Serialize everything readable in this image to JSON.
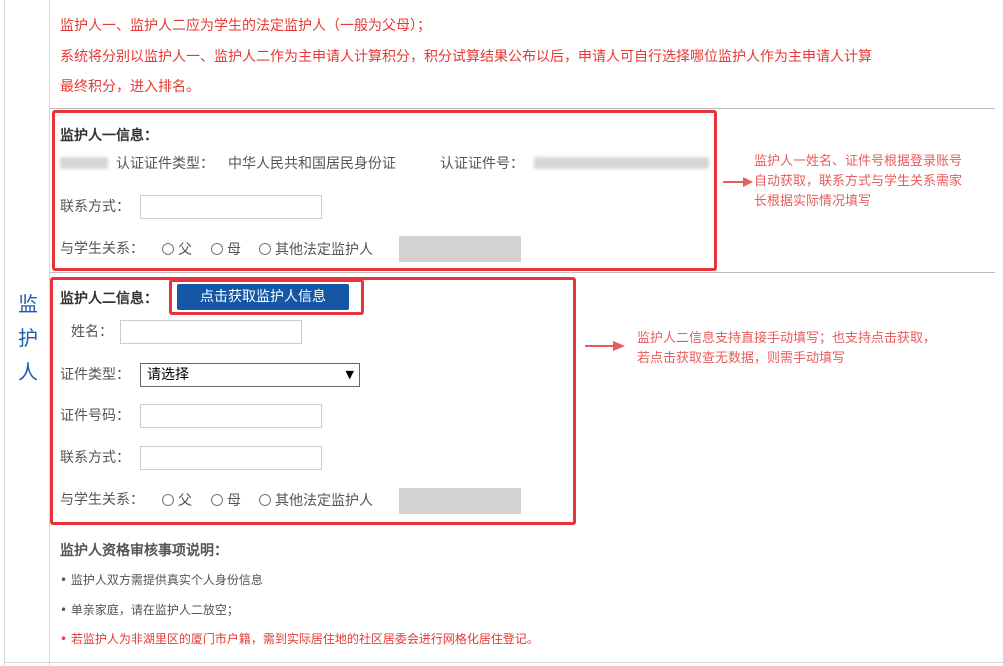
{
  "side_title": "监护人",
  "top_notes": [
    "监护人一、监护人二应为学生的法定监护人（一般为父母）；",
    "系统将分别以监护人一、监护人二作为主申请人计算积分，积分试算结果公布以后，申请人可自行选择哪位监护人作为主申请人计算",
    "最终积分，进入排名。"
  ],
  "guardian1": {
    "title": "监护人一信息：",
    "cert_type_label": "认证证件类型：",
    "cert_type_value": "中华人民共和国居民身份证",
    "cert_no_label": "认证证件号：",
    "contact_label": "联系方式：",
    "contact_value": "",
    "relation_label": "与学生关系：",
    "relation_options": [
      "父",
      "母",
      "其他法定监护人"
    ]
  },
  "guardian2": {
    "title": "监护人二信息：",
    "fetch_button": "点击获取监护人信息",
    "name_label": "姓名：",
    "name_value": "",
    "cert_type_label": "证件类型：",
    "cert_type_selected": "请选择",
    "cert_no_label": "证件号码：",
    "cert_no_value": "",
    "contact_label": "联系方式：",
    "contact_value": "",
    "relation_label": "与学生关系：",
    "relation_options": [
      "父",
      "母",
      "其他法定监护人"
    ]
  },
  "annotations": {
    "g1": [
      "监护人一姓名、证件号根据登录账号",
      "自动获取，联系方式与学生关系需家",
      "长根据实际情况填写"
    ],
    "g2": [
      "监护人二信息支持直接手动填写；也支持点击获取，",
      "若点击获取查无数据，则需手动填写"
    ]
  },
  "review": {
    "title": "监护人资格审核事项说明：",
    "items": [
      "• 监护人双方需提供真实个人身份信息",
      "• 单亲家庭，请在监护人二放空；",
      "• 若监护人为非湖里区的厦门市户籍，需到实际居住地的社区居委会进行网格化居住登记。"
    ]
  },
  "colors": {
    "accent_red": "#e8333a",
    "button_blue": "#1557a4",
    "side_title_blue": "#1a5fa8"
  }
}
